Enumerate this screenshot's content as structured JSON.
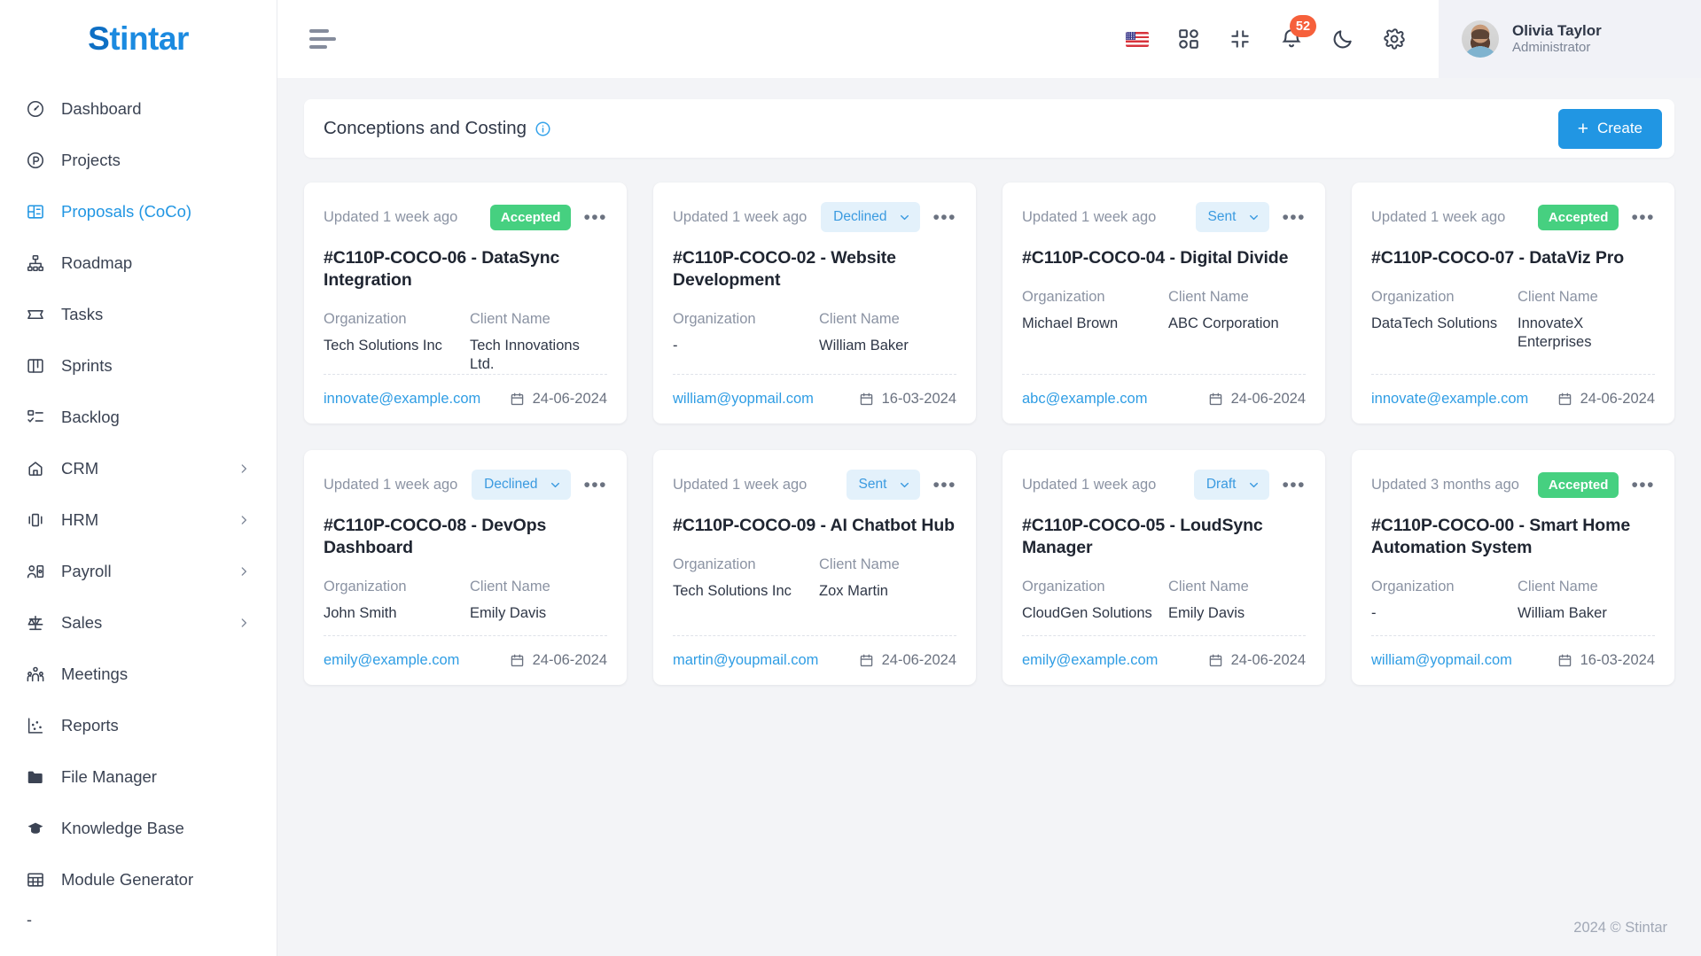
{
  "brand": {
    "name": "Stintar",
    "accent": "#2196e3"
  },
  "sidebar": {
    "items": [
      {
        "label": "Dashboard",
        "icon": "gauge-icon",
        "active": false,
        "expandable": false
      },
      {
        "label": "Projects",
        "icon": "projects-icon",
        "active": false,
        "expandable": false
      },
      {
        "label": "Proposals (CoCo)",
        "icon": "proposals-icon",
        "active": true,
        "expandable": false
      },
      {
        "label": "Roadmap",
        "icon": "roadmap-icon",
        "active": false,
        "expandable": false
      },
      {
        "label": "Tasks",
        "icon": "tasks-icon",
        "active": false,
        "expandable": false
      },
      {
        "label": "Sprints",
        "icon": "sprints-icon",
        "active": false,
        "expandable": false
      },
      {
        "label": "Backlog",
        "icon": "backlog-icon",
        "active": false,
        "expandable": false
      },
      {
        "label": "CRM",
        "icon": "crm-icon",
        "active": false,
        "expandable": true
      },
      {
        "label": "HRM",
        "icon": "hrm-icon",
        "active": false,
        "expandable": true
      },
      {
        "label": "Payroll",
        "icon": "payroll-icon",
        "active": false,
        "expandable": true
      },
      {
        "label": "Sales",
        "icon": "sales-icon",
        "active": false,
        "expandable": true
      },
      {
        "label": "Meetings",
        "icon": "meetings-icon",
        "active": false,
        "expandable": false
      },
      {
        "label": "Reports",
        "icon": "reports-icon",
        "active": false,
        "expandable": false
      },
      {
        "label": "File Manager",
        "icon": "folder-icon",
        "active": false,
        "expandable": false
      },
      {
        "label": "Knowledge Base",
        "icon": "graduation-cap-icon",
        "active": false,
        "expandable": false
      },
      {
        "label": "Module Generator",
        "icon": "table-grid-icon",
        "active": false,
        "expandable": false
      }
    ],
    "truncated_item": "-"
  },
  "topbar": {
    "menu_toggle": "hamburger-icon",
    "icons": [
      {
        "name": "language-flag-icon",
        "label": "US"
      },
      {
        "name": "apps-grid-icon",
        "label": "Apps"
      },
      {
        "name": "compress-icon",
        "label": "Fullscreen"
      },
      {
        "name": "bell-icon",
        "label": "Notifications",
        "badge": "52"
      },
      {
        "name": "moon-icon",
        "label": "Dark mode"
      },
      {
        "name": "gear-icon",
        "label": "Settings"
      }
    ],
    "notification_badge": "52",
    "user": {
      "name": "Olivia Taylor",
      "role": "Administrator"
    }
  },
  "panel": {
    "title": "Conceptions and Costing",
    "info_icon": "info-circle-icon",
    "create_label": "Create",
    "create_plus": "+"
  },
  "card_labels": {
    "organization": "Organization",
    "client_name": "Client Name",
    "menu": "•••"
  },
  "cards": [
    {
      "updated": "Updated 1 week ago",
      "status": "Accepted",
      "status_type": "solid",
      "title": "#C110P-COCO-06 - DataSync Integration",
      "organization": "Tech Solutions Inc",
      "client": "Tech Innovations Ltd.",
      "email": "innovate@example.com",
      "date": "24-06-2024"
    },
    {
      "updated": "Updated 1 week ago",
      "status": "Declined",
      "status_type": "select",
      "title": "#C110P-COCO-02 - Website Development",
      "organization": "-",
      "client": "William Baker",
      "email": "william@yopmail.com",
      "date": "16-03-2024"
    },
    {
      "updated": "Updated 1 week ago",
      "status": "Sent",
      "status_type": "select",
      "title": "#C110P-COCO-04 - Digital Divide",
      "organization": "Michael Brown",
      "client": "ABC Corporation",
      "email": "abc@example.com",
      "date": "24-06-2024"
    },
    {
      "updated": "Updated 1 week ago",
      "status": "Accepted",
      "status_type": "solid",
      "title": "#C110P-COCO-07 - DataViz Pro",
      "organization": "DataTech Solutions",
      "client": "InnovateX Enterprises",
      "email": "innovate@example.com",
      "date": "24-06-2024"
    },
    {
      "updated": "Updated 1 week ago",
      "status": "Declined",
      "status_type": "select",
      "title": "#C110P-COCO-08 - DevOps Dashboard",
      "organization": "John Smith",
      "client": "Emily Davis",
      "email": "emily@example.com",
      "date": "24-06-2024"
    },
    {
      "updated": "Updated 1 week ago",
      "status": "Sent",
      "status_type": "select",
      "title": "#C110P-COCO-09 - AI Chatbot Hub",
      "organization": "Tech Solutions Inc",
      "client": "Zox Martin",
      "email": "martin@youpmail.com",
      "date": "24-06-2024"
    },
    {
      "updated": "Updated 1 week ago",
      "status": "Draft",
      "status_type": "select",
      "title": "#C110P-COCO-05 - LoudSync Manager",
      "organization": "CloudGen Solutions",
      "client": "Emily Davis",
      "email": "emily@example.com",
      "date": "24-06-2024"
    },
    {
      "updated": "Updated 3 months ago",
      "status": "Accepted",
      "status_type": "solid",
      "title": "#C110P-COCO-00 - Smart Home Automation System",
      "organization": "-",
      "client": "William Baker",
      "email": "william@yopmail.com",
      "date": "16-03-2024"
    }
  ],
  "footer": {
    "copyright": "2024 © Stintar"
  },
  "colors": {
    "accent": "#2196e3",
    "accepted_badge": "#46d080",
    "select_badge_bg": "#e3f1fb",
    "select_badge_text": "#3a9ae0",
    "notification_badge": "#f6603b",
    "link": "#2f9de4"
  }
}
